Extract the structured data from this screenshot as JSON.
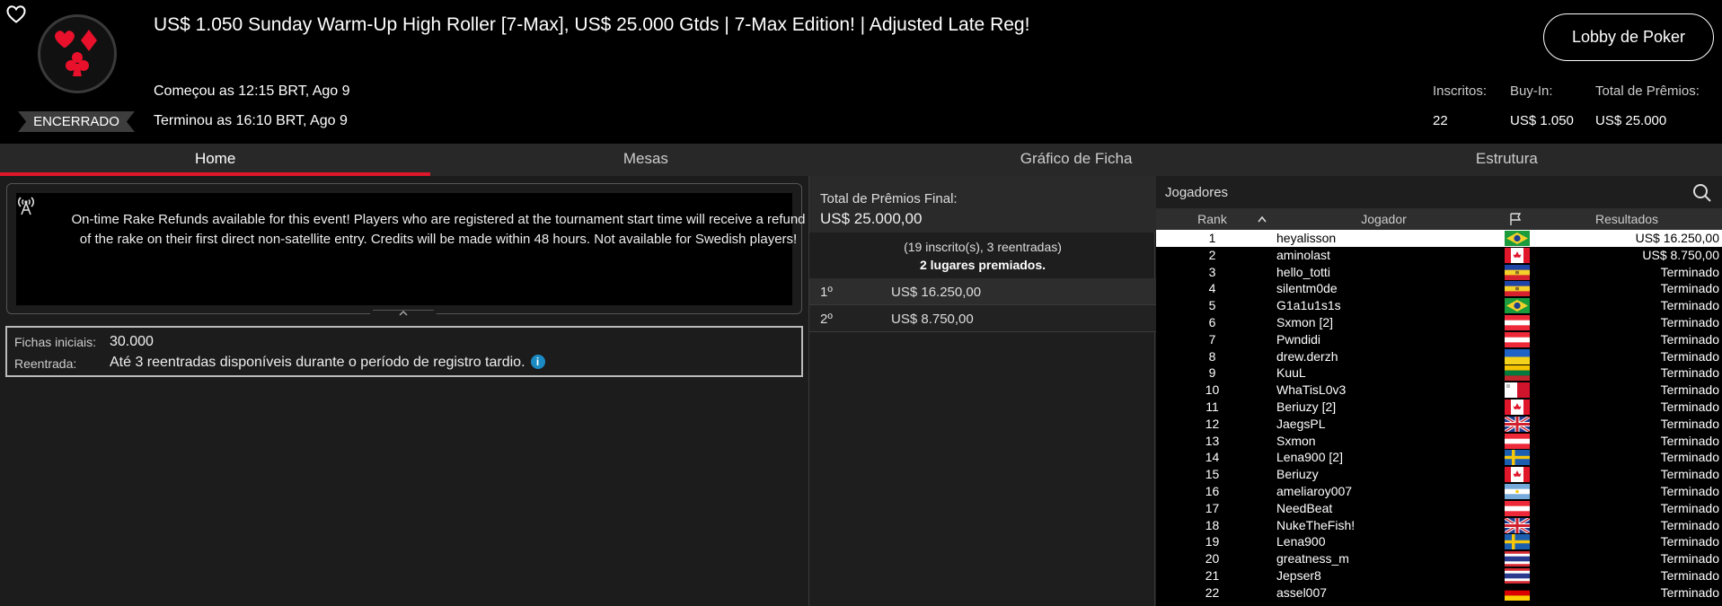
{
  "header": {
    "title": "US$ 1.050 Sunday Warm-Up High Roller [7-Max], US$ 25.000 Gtds | 7-Max Edition! | Adjusted Late Reg!",
    "status": "ENCERRADO",
    "started": "Começou as 12:15 BRT, Ago 9",
    "ended": "Terminou as 16:10 BRT, Ago 9",
    "lobby_button": "Lobby de Poker",
    "stats": {
      "entries_label": "Inscritos:",
      "entries_value": "22",
      "buyin_label": "Buy-In:",
      "buyin_value": "US$ 1.050",
      "prize_label": "Total de Prêmios:",
      "prize_value": "US$ 25.000"
    }
  },
  "tabs": [
    "Home",
    "Mesas",
    "Gráfico de Ficha",
    "Estrutura"
  ],
  "home": {
    "notice": "On-time Rake Refunds available for this event! Players who are registered at the tournament start time will receive a refund of the rake on their first direct non-satellite entry. Credits will be made within 48 hours. Not available for Swedish players!",
    "starting_chips_label": "Fichas iniciais:",
    "starting_chips_value": "30.000",
    "reentry_label": "Reentrada:",
    "reentry_value": "Até 3 reentradas disponíveis durante o período de registro tardio.",
    "info_glyph": "i"
  },
  "prizes": {
    "label": "Total de Prêmios Final:",
    "value": "US$ 25.000,00",
    "entrants": "(19 inscrito(s), 3 reentradas)",
    "places": "2 lugares premiados.",
    "payouts": [
      {
        "pos": "1º",
        "amount": "US$ 16.250,00"
      },
      {
        "pos": "2º",
        "amount": "US$ 8.750,00"
      }
    ]
  },
  "players": {
    "title": "Jogadores",
    "columns": {
      "rank": "Rank",
      "player": "Jogador",
      "result": "Resultados"
    },
    "rows": [
      {
        "rank": "1",
        "name": "heyalisson",
        "flag": "br",
        "result": "US$ 16.250,00"
      },
      {
        "rank": "2",
        "name": "aminolast",
        "flag": "ca",
        "result": "US$ 8.750,00"
      },
      {
        "rank": "3",
        "name": "hello_totti",
        "flag": "md",
        "result": "Terminado"
      },
      {
        "rank": "4",
        "name": "silentm0de",
        "flag": "md",
        "result": "Terminado"
      },
      {
        "rank": "5",
        "name": "G1a1u1s1s",
        "flag": "br",
        "result": "Terminado"
      },
      {
        "rank": "6",
        "name": "Sxmon [2]",
        "flag": "at",
        "result": "Terminado"
      },
      {
        "rank": "7",
        "name": "Pwndidi",
        "flag": "at",
        "result": "Terminado"
      },
      {
        "rank": "8",
        "name": "drew.derzh",
        "flag": "ua",
        "result": "Terminado"
      },
      {
        "rank": "9",
        "name": "KuuL",
        "flag": "lt",
        "result": "Terminado"
      },
      {
        "rank": "10",
        "name": "WhaTisL0v3",
        "flag": "mt",
        "result": "Terminado"
      },
      {
        "rank": "11",
        "name": "Beriuzy [2]",
        "flag": "ca",
        "result": "Terminado"
      },
      {
        "rank": "12",
        "name": "JaegsPL",
        "flag": "gb",
        "result": "Terminado"
      },
      {
        "rank": "13",
        "name": "Sxmon",
        "flag": "at",
        "result": "Terminado"
      },
      {
        "rank": "14",
        "name": "Lena900 [2]",
        "flag": "se",
        "result": "Terminado"
      },
      {
        "rank": "15",
        "name": "Beriuzy",
        "flag": "ca",
        "result": "Terminado"
      },
      {
        "rank": "16",
        "name": "ameliaroy007",
        "flag": "ar",
        "result": "Terminado"
      },
      {
        "rank": "17",
        "name": "NeedBeat",
        "flag": "at",
        "result": "Terminado"
      },
      {
        "rank": "18",
        "name": "NukeTheFish!",
        "flag": "gb",
        "result": "Terminado"
      },
      {
        "rank": "19",
        "name": "Lena900",
        "flag": "se",
        "result": "Terminado"
      },
      {
        "rank": "20",
        "name": "greatness_m",
        "flag": "th",
        "result": "Terminado"
      },
      {
        "rank": "21",
        "name": "Jepser8",
        "flag": "th",
        "result": "Terminado"
      },
      {
        "rank": "22",
        "name": "assel007",
        "flag": "de",
        "result": "Terminado"
      }
    ]
  },
  "colors": {
    "accent": "#e0162b",
    "info": "#1b8bc4"
  }
}
